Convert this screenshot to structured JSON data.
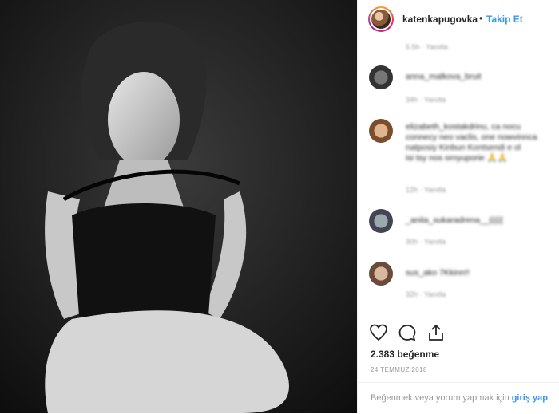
{
  "post": {
    "username": "katenkapugovka",
    "separator": "•",
    "follow_label": "Takip Et",
    "likes_text": "2.383 beğenme",
    "date": "24 TEMMUZ 2018"
  },
  "comments": [
    {
      "text": "5.5h · Yanıtla",
      "meta": ""
    },
    {
      "text": "anna_malkova_bruit",
      "meta": "34h · Yanıtla"
    },
    {
      "text": "elizabeth_kostakdrinu, ca nocu\nconnecy neo vaclis, one nowvinnca\nnatposiy Kinbun Kontsendi e ol\nisi tsy nos ornyuporie 🙏🙏",
      "meta": "12h · Yanıtla"
    },
    {
      "text": "_anita_sukaradrena__(((((",
      "meta": "30h · Yanıtla"
    },
    {
      "text": "sus_ako 7Kkinn!!",
      "meta": "32h · Yanıtla"
    }
  ],
  "footer": {
    "text": "Beğenmek veya yorum yapmak için",
    "link": "giriş yap"
  },
  "icons": [
    "heart-icon",
    "comment-icon",
    "share-icon"
  ],
  "colors": {
    "link": "#3897f0",
    "text": "#262626",
    "muted": "#999999"
  }
}
